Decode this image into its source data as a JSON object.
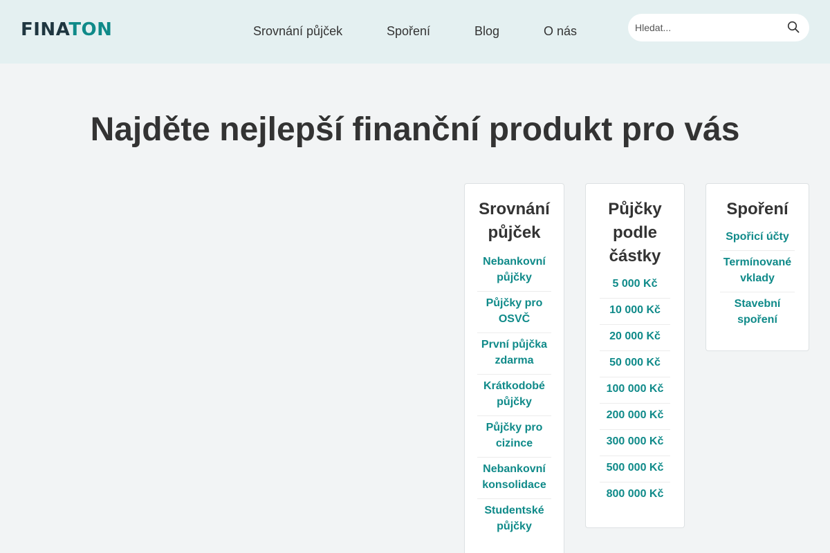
{
  "brand": {
    "part1": "FINA",
    "part2": "TON",
    "accent": "#0f8a89",
    "dark": "#1f3640"
  },
  "nav": [
    {
      "label": "Srovnání půjček"
    },
    {
      "label": "Spoření"
    },
    {
      "label": "Blog"
    },
    {
      "label": "O nás"
    }
  ],
  "search": {
    "placeholder": "Hledat...",
    "icon": "search-icon"
  },
  "hero": {
    "title": "Najděte nejlepší finanční produkt pro vás"
  },
  "cards": [
    {
      "title": "Srovnání půjček",
      "links": [
        "Nebankovní půjčky",
        "Půjčky pro OSVČ",
        "První půjčka zdarma",
        "Krátkodobé půjčky",
        "Půjčky pro cizince",
        "Nebankovní konsolidace",
        "Studentské půjčky"
      ]
    },
    {
      "title": "Půjčky podle částky",
      "links": [
        "5 000 Kč",
        "10 000 Kč",
        "20 000 Kč",
        "50 000 Kč",
        "100 000 Kč",
        "200 000 Kč",
        "300 000 Kč",
        "500 000 Kč",
        "800 000 Kč"
      ]
    },
    {
      "title": "Spoření",
      "links": [
        "Spořicí účty",
        "Termínované vklady",
        "Stavební spoření"
      ]
    }
  ]
}
